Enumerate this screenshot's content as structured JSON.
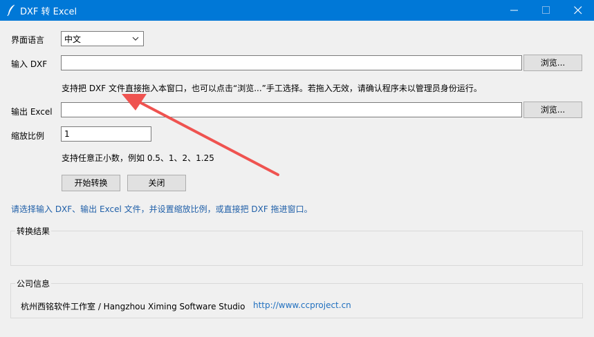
{
  "window": {
    "title": "DXF 转 Excel"
  },
  "form": {
    "language_label": "界面语言",
    "language_value": "中文",
    "input_label": "输入 DXF",
    "input_value": "",
    "browse_input_label": "浏览...",
    "input_hint": "支持把 DXF 文件直接拖入本窗口，也可以点击“浏览...”手工选择。若拖入无效，请确认程序未以管理员身份运行。",
    "output_label": "输出 Excel",
    "output_value": "",
    "browse_output_label": "浏览...",
    "scale_label": "缩放比例",
    "scale_value": "1",
    "scale_hint": "支持任意正小数，例如 0.5、1、2、1.25",
    "convert_button": "开始转换",
    "close_button": "关闭"
  },
  "status_text": "请选择输入 DXF、输出 Excel 文件，并设置缩放比例，或直接把 DXF 拖进窗口。",
  "result_group": {
    "title": "转换结果",
    "content": ""
  },
  "company_group": {
    "title": "公司信息",
    "name": "杭州西铭软件工作室 / Hangzhou Ximing Software Studio",
    "url": "http://www.ccproject.cn"
  },
  "colors": {
    "titlebar": "#0078d7",
    "status_text": "#1f5fa8",
    "link": "#1f6fbf",
    "annotation_arrow": "#ef5350"
  },
  "icons": [
    "feather-icon",
    "minimize-icon",
    "maximize-icon",
    "close-icon",
    "chevron-down-icon",
    "annotation-arrow"
  ]
}
